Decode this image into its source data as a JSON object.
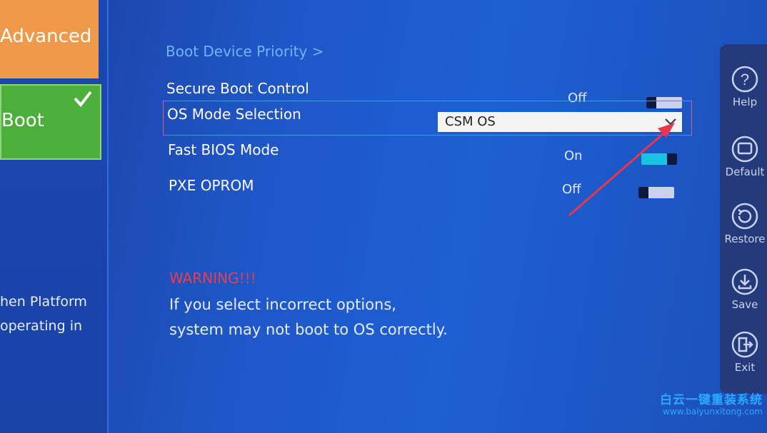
{
  "sidebar": {
    "tabs": [
      {
        "label": "Advanced",
        "color": "#f0994b"
      },
      {
        "label": "Boot",
        "color": "#4caf3c",
        "selected": true
      }
    ],
    "description_lines": [
      "hen Platform",
      "operating in"
    ]
  },
  "main": {
    "link": "Boot Device Priority >",
    "settings": [
      {
        "label": "Secure Boot Control",
        "value": "Off",
        "control": "toggle",
        "state": "off"
      },
      {
        "label": "OS Mode Selection",
        "value": "CSM OS",
        "control": "dropdown"
      },
      {
        "label": "Fast BIOS Mode",
        "value": "On",
        "control": "toggle",
        "state": "on"
      },
      {
        "label": "PXE OPROM",
        "value": "Off",
        "control": "toggle",
        "state": "off"
      }
    ],
    "warning": {
      "title": "WARNING!!!",
      "lines": [
        "If you select incorrect options,",
        "system may not boot to OS correctly."
      ]
    }
  },
  "side_panel": {
    "buttons": [
      {
        "label": "Help",
        "icon": "help-icon"
      },
      {
        "label": "Default",
        "icon": "monitor-icon"
      },
      {
        "label": "Restore",
        "icon": "restore-icon"
      },
      {
        "label": "Save",
        "icon": "save-icon"
      },
      {
        "label": "Exit",
        "icon": "exit-icon"
      }
    ]
  },
  "watermark": {
    "text": "白云一键重装系统",
    "url": "www.baiyunxitong.com"
  },
  "colors": {
    "accent_link": "#6fb5ff",
    "warning": "#e3414f",
    "toggle_on": "#19c2e0",
    "highlight": "#e85a6a"
  }
}
